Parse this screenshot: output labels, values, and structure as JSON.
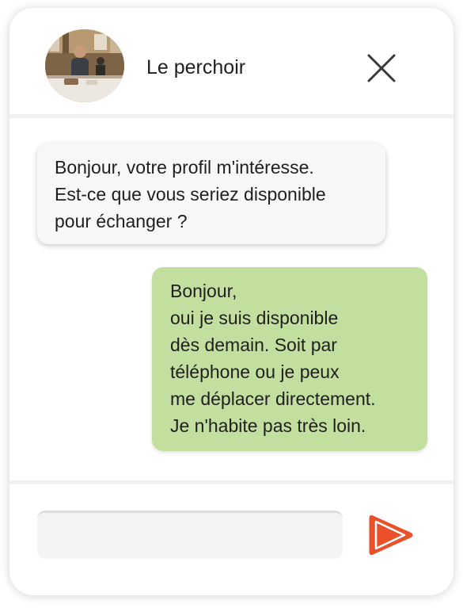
{
  "header": {
    "title": "Le perchoir",
    "close_icon": "close-icon"
  },
  "messages": [
    {
      "direction": "incoming",
      "lines": [
        "Bonjour, votre profil m'intéresse.",
        "Est-ce que vous seriez disponible",
        "pour échanger ?"
      ]
    },
    {
      "direction": "outgoing",
      "lines": [
        "Bonjour,",
        "oui je suis disponible",
        "dès demain. Soit par",
        "téléphone ou je peux",
        "me déplacer directement.",
        "Je n'habite pas très loin."
      ]
    }
  ],
  "composer": {
    "value": "",
    "placeholder": "",
    "send_icon": "send-icon"
  },
  "colors": {
    "outgoing_bubble": "#c3df9f",
    "incoming_bubble": "#f8f8f8",
    "send_accent": "#e8512a"
  }
}
